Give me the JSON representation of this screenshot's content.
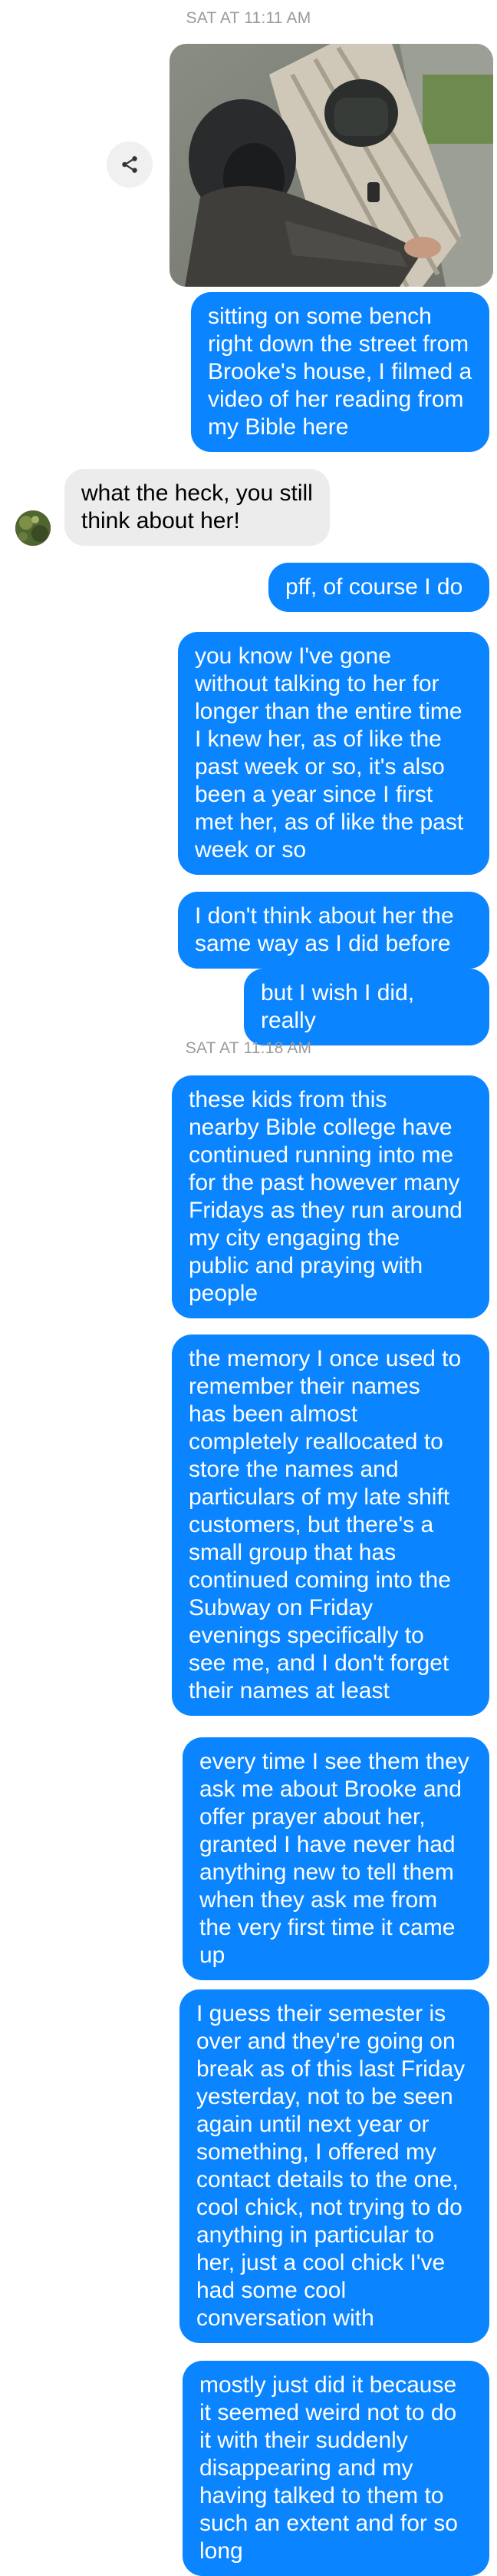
{
  "thread": {
    "timestamp_1": "SAT AT 11:11 AM",
    "timestamp_2": "SAT AT 11:18 AM",
    "photo_icon": "photo-of-person-on-bench",
    "share_icon": "share-icon",
    "avatar_icon": "contact-avatar",
    "messages": [
      {
        "from": "me",
        "text": "sitting on some bench\nright down the street from\nBrooke's house, I filmed a\nvideo of her reading from\nmy Bible here"
      },
      {
        "from": "them",
        "text": "what the heck, you still\nthink about her!"
      },
      {
        "from": "me",
        "text": "pff, of course I do"
      },
      {
        "from": "me",
        "text": "you know I've gone\nwithout talking to her for\nlonger than the entire time\nI knew her, as of like the\npast week or so, it's also\nbeen a year since I first\nmet her, as of like the past\nweek or so"
      },
      {
        "from": "me",
        "text": "I don't think about her the\nsame way as I did before"
      },
      {
        "from": "me",
        "text": "but I wish I did, really"
      },
      {
        "from": "me",
        "text": "these kids from this\nnearby Bible college have\ncontinued running into me\nfor the past however many\nFridays as they run around\nmy city engaging the\npublic and praying with\npeople"
      },
      {
        "from": "me",
        "text": "the memory I once used to\nremember their names\nhas been almost\ncompletely reallocated to\nstore the names and\nparticulars of my late shift\ncustomers, but there's a\nsmall group that has\ncontinued coming into the\nSubway on Friday\nevenings specifically to\nsee me, and I don't forget\ntheir names at least"
      },
      {
        "from": "me",
        "text": "every time I see them they\nask me about Brooke and\noffer prayer about her,\ngranted I have never had\nanything new to tell them\nwhen they ask me from\nthe very first time it came\nup"
      },
      {
        "from": "me",
        "text": "I guess their semester is\nover and they're going on\nbreak as of this last Friday\nyesterday, not to be seen\nagain until next year or\nsomething, I offered my\ncontact details to the one,\ncool chick, not trying to do\nanything in particular to\nher, just a cool chick I've\nhad some cool\nconversation with"
      },
      {
        "from": "me",
        "text": "mostly just did it because\nit seemed weird not to do\nit with their suddenly\ndisappearing and my\nhaving talked to them to\nsuch an extent and for so\nlong"
      }
    ],
    "colors": {
      "outgoing": "#0a84ff",
      "incoming": "#ececec",
      "timestamp": "#9a9a9a"
    }
  }
}
